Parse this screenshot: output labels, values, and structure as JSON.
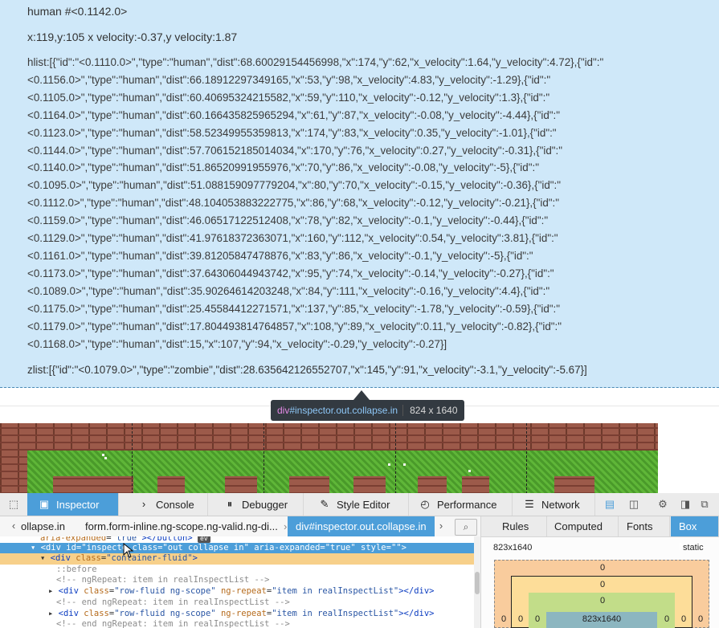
{
  "inspector": {
    "human_id": "human #<0.1142.0>",
    "position": "x:119,y:105 x velocity:-0.37,y velocity:1.87",
    "hlist_lines": [
      "hlist:[{\"id\":\"<0.1110.0>\",\"type\":\"human\",\"dist\":68.60029154456998,\"x\":174,\"y\":62,\"x_velocity\":1.64,\"y_velocity\":4.72},{\"id\":\"",
      "<0.1156.0>\",\"type\":\"human\",\"dist\":66.18912297349165,\"x\":53,\"y\":98,\"x_velocity\":4.83,\"y_velocity\":-1.29},{\"id\":\"",
      "<0.1105.0>\",\"type\":\"human\",\"dist\":60.40695324215582,\"x\":59,\"y\":110,\"x_velocity\":-0.12,\"y_velocity\":1.3},{\"id\":\"",
      "<0.1164.0>\",\"type\":\"human\",\"dist\":60.166435825965294,\"x\":61,\"y\":87,\"x_velocity\":-0.08,\"y_velocity\":-4.44},{\"id\":\"",
      "<0.1123.0>\",\"type\":\"human\",\"dist\":58.52349955359813,\"x\":174,\"y\":83,\"x_velocity\":0.35,\"y_velocity\":-1.01},{\"id\":\"",
      "<0.1144.0>\",\"type\":\"human\",\"dist\":57.706152185014034,\"x\":170,\"y\":76,\"x_velocity\":0.27,\"y_velocity\":-0.31},{\"id\":\"",
      "<0.1140.0>\",\"type\":\"human\",\"dist\":51.86520991955976,\"x\":70,\"y\":86,\"x_velocity\":-0.08,\"y_velocity\":-5},{\"id\":\"",
      "<0.1095.0>\",\"type\":\"human\",\"dist\":51.088159097779204,\"x\":80,\"y\":70,\"x_velocity\":-0.15,\"y_velocity\":-0.36},{\"id\":\"",
      "<0.1112.0>\",\"type\":\"human\",\"dist\":48.104053883222775,\"x\":86,\"y\":68,\"x_velocity\":-0.12,\"y_velocity\":-0.21},{\"id\":\"",
      "<0.1159.0>\",\"type\":\"human\",\"dist\":46.06517122512408,\"x\":78,\"y\":82,\"x_velocity\":-0.1,\"y_velocity\":-0.44},{\"id\":\"",
      "<0.1129.0>\",\"type\":\"human\",\"dist\":41.97618372363071,\"x\":160,\"y\":112,\"x_velocity\":0.54,\"y_velocity\":3.81},{\"id\":\"",
      "<0.1161.0>\",\"type\":\"human\",\"dist\":39.81205847478876,\"x\":83,\"y\":86,\"x_velocity\":-0.1,\"y_velocity\":-5},{\"id\":\"",
      "<0.1173.0>\",\"type\":\"human\",\"dist\":37.64306044943742,\"x\":95,\"y\":74,\"x_velocity\":-0.14,\"y_velocity\":-0.27},{\"id\":\"",
      "<0.1089.0>\",\"type\":\"human\",\"dist\":35.90264614203248,\"x\":84,\"y\":111,\"x_velocity\":-0.16,\"y_velocity\":4.4},{\"id\":\"",
      "<0.1175.0>\",\"type\":\"human\",\"dist\":25.45584412271571,\"x\":137,\"y\":85,\"x_velocity\":-1.78,\"y_velocity\":-0.59},{\"id\":\"",
      "<0.1179.0>\",\"type\":\"human\",\"dist\":17.804493814764857,\"x\":108,\"y\":89,\"x_velocity\":0.11,\"y_velocity\":-0.82},{\"id\":\"",
      "<0.1168.0>\",\"type\":\"human\",\"dist\":15,\"x\":107,\"y\":94,\"x_velocity\":-0.29,\"y_velocity\":-0.27}]"
    ],
    "zlist": "zlist:[{\"id\":\"<0.1079.0>\",\"type\":\"zombie\",\"dist\":28.635642126552707,\"x\":145,\"y\":91,\"x_velocity\":-3.1,\"y_velocity\":-5.67}]"
  },
  "tooltip": {
    "tag": "div",
    "id": "#inspector",
    "classes": ".out.collapse.in",
    "size": "824 x 1640"
  },
  "devtools": {
    "tabs": [
      {
        "label": "Inspector",
        "icon": "inspector-icon"
      },
      {
        "label": "Console",
        "icon": "console-icon"
      },
      {
        "label": "Debugger",
        "icon": "debugger-icon"
      },
      {
        "label": "Style Editor",
        "icon": "style-editor-icon"
      },
      {
        "label": "Performance",
        "icon": "performance-icon"
      },
      {
        "label": "Network",
        "icon": "network-icon"
      }
    ],
    "breadcrumbs": {
      "first": "ollapse.in",
      "second": "form.form-inline.ng-scope.ng-valid.ng-di...",
      "selected": "div#inspector.out.collapse.in"
    },
    "markup": {
      "row0": {
        "attr": "aria-expanded",
        "val": "\"true\"",
        "tail": "></button>",
        "badge": "ev"
      },
      "row1": {
        "open": "<div ",
        "a1": "id",
        "v1": "\"inspecto",
        "a2": " class",
        "v2": "\"out collapse in\"",
        "a3": " aria-expanded",
        "v3": "\"true\"",
        "a4": " style",
        "v4": "\"\"",
        "close": ">"
      },
      "row2": {
        "open": "<div ",
        "a1": "class",
        "v1": "\"container-fluid\"",
        "close": ">"
      },
      "row3": "::before",
      "row4": "<!-- ngRepeat: item in realInspectList -->",
      "row5": {
        "open": "<div ",
        "a1": "class",
        "v1": "\"row-fluid ng-scope\"",
        "a2": " ng-repeat",
        "v2": "\"item in realInspectList\"",
        "close": "></div>"
      },
      "row6": "<!-- end ngRepeat: item in realInspectList -->",
      "row7": {
        "open": "<div ",
        "a1": "class",
        "v1": "\"row-fluid ng-scope\"",
        "a2": " ng-repeat",
        "v2": "\"item in realInspectList\"",
        "close": "></div>"
      },
      "row8": "<!-- end ngRepeat: item in realInspectList -->"
    },
    "side_tabs": [
      "Rules",
      "Computed",
      "Fonts",
      "Box Mod"
    ],
    "box_model": {
      "dimensions": "823x1640",
      "position": "static",
      "margin_top": "0",
      "border_top": "0",
      "padding_top": "0",
      "content": "823x1640",
      "left_values": [
        "0",
        "0",
        "0"
      ],
      "right_values": [
        "0",
        "0",
        "0"
      ]
    }
  }
}
